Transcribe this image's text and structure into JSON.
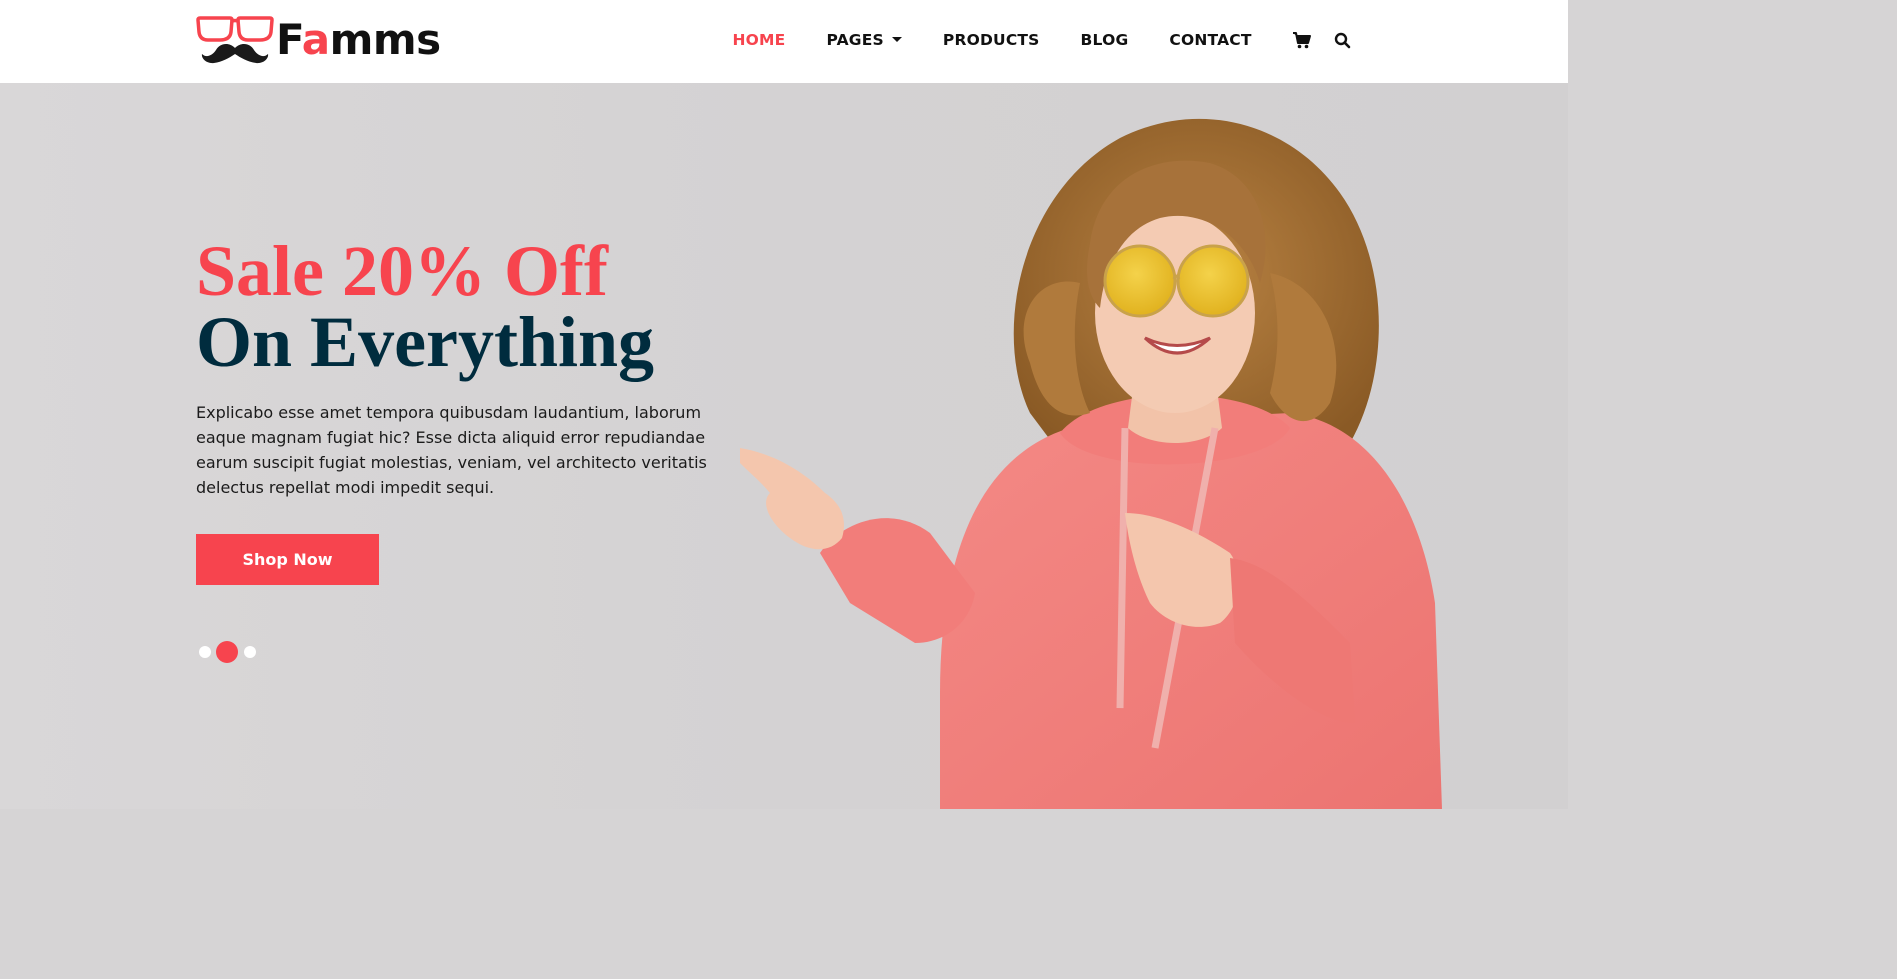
{
  "brand": {
    "logo_text_pre": "F",
    "logo_text_accent": "a",
    "logo_text_post": "mms",
    "accent_color": "#f7444e",
    "dark_color": "#002c3e"
  },
  "nav": {
    "items": [
      {
        "label": "HOME",
        "active": true
      },
      {
        "label": "PAGES",
        "dropdown": true
      },
      {
        "label": "PRODUCTS"
      },
      {
        "label": "BLOG"
      },
      {
        "label": "CONTACT"
      }
    ],
    "icons": [
      "cart-icon",
      "search-icon"
    ]
  },
  "hero": {
    "title_line1": "Sale 20% Off",
    "title_line2": "On Everything",
    "description": "Explicabo esse amet tempora quibusdam laudantium, laborum eaque magnam fugiat hic? Esse dicta aliquid error repudiandae earum suscipit fugiat molestias, veniam, vel architecto veritatis delectus repellat modi impedit sequi.",
    "cta_label": "Shop Now",
    "slides": 3,
    "active_slide": 2
  }
}
